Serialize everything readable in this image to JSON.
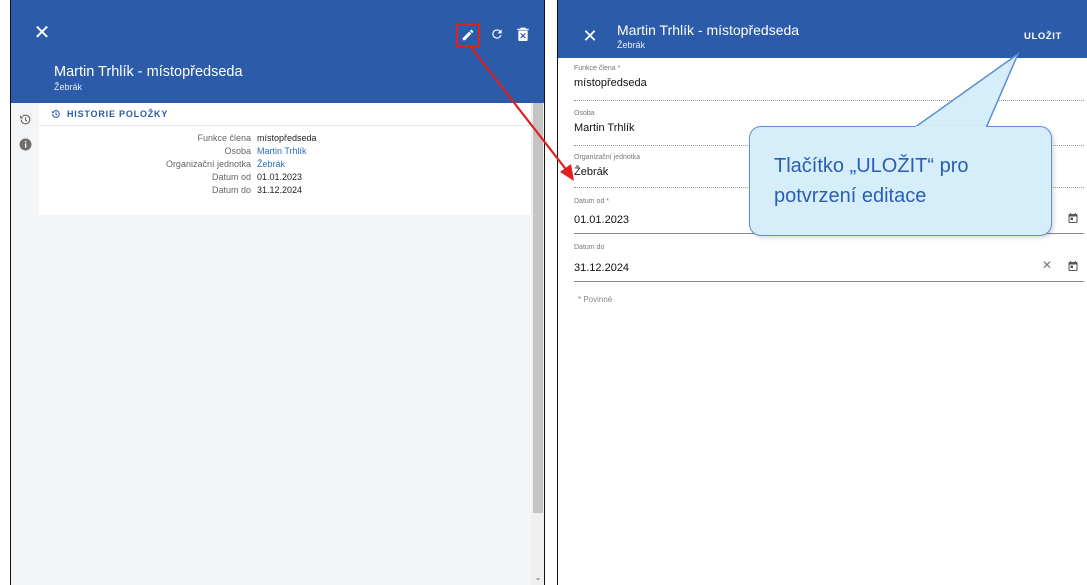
{
  "left_panel": {
    "title": "Martin Trhlík - místopředseda",
    "subtitle": "Žebrák",
    "tab_history": "HISTORIE POLOŽKY",
    "details": [
      {
        "key": "Funkce člena",
        "value": "místopředseda",
        "link": false
      },
      {
        "key": "Osoba",
        "value": "Martin Trhlík",
        "link": true
      },
      {
        "key": "Organizační jednotka",
        "value": "Žebrák",
        "link": true
      },
      {
        "key": "Datum od",
        "value": "01.01.2023",
        "link": false
      },
      {
        "key": "Datum do",
        "value": "31.12.2024",
        "link": false
      }
    ]
  },
  "right_panel": {
    "title": "Martin Trhlík - místopředseda",
    "subtitle": "Žebrák",
    "save_label": "ULOŽIT",
    "fields": {
      "function": {
        "label": "Funkce člena *",
        "value": "místopředseda"
      },
      "person": {
        "label": "Osoba",
        "value": "Martin Trhlík"
      },
      "org_unit": {
        "label": "Organizační jednotka",
        "value": "Žebrák"
      },
      "date_from": {
        "label": "Datum od *",
        "value": "01.01.2023"
      },
      "date_to": {
        "label": "Datum do",
        "value": "31.12.2024"
      }
    },
    "required_note": "* Povinné"
  },
  "callout": {
    "text": "Tlačítko „ULOŽIT“ pro potvrzení editace"
  },
  "icons": {
    "close": "close-icon",
    "edit": "pencil-icon",
    "refresh": "refresh-icon",
    "delete": "delete-icon",
    "history": "history-icon",
    "info": "info-icon",
    "calendar": "calendar-icon",
    "clear": "clear-icon"
  },
  "colors": {
    "header_blue": "#2c5ba9",
    "link_blue": "#2c6fc2",
    "highlight_red": "#e02020",
    "callout_fill": "#d6eefa",
    "callout_border": "#5a8ed6"
  }
}
